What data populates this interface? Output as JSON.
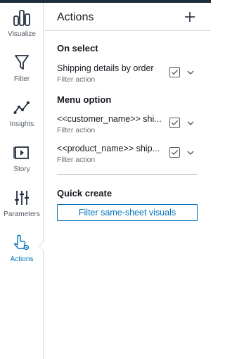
{
  "colors": {
    "accent": "#0073bb",
    "text": "#16191f",
    "muted": "#687078",
    "border": "#d5dbdb",
    "topbar": "#1d2b3a"
  },
  "rail": {
    "items": [
      {
        "label": "Visualize",
        "icon": "bar-chart-icon",
        "active": false
      },
      {
        "label": "Filter",
        "icon": "funnel-icon",
        "active": false
      },
      {
        "label": "Insights",
        "icon": "sparkline-icon",
        "active": false
      },
      {
        "label": "Story",
        "icon": "story-icon",
        "active": false
      },
      {
        "label": "Parameters",
        "icon": "sliders-icon",
        "active": false
      },
      {
        "label": "Actions",
        "icon": "pointer-click-icon",
        "active": true
      }
    ]
  },
  "panel": {
    "title": "Actions",
    "add_icon": "plus-icon",
    "sections": {
      "on_select": {
        "title": "On select",
        "actions": [
          {
            "name": "Shipping details by order",
            "type": "Filter action",
            "checked": true
          }
        ]
      },
      "menu_option": {
        "title": "Menu option",
        "actions": [
          {
            "name": "<<customer_name>> shi...",
            "type": "Filter action",
            "checked": true
          },
          {
            "name": "<<product_name>> ship...",
            "type": "Filter action",
            "checked": true
          }
        ]
      },
      "quick_create": {
        "title": "Quick create",
        "button_label": "Filter same-sheet visuals"
      }
    }
  }
}
